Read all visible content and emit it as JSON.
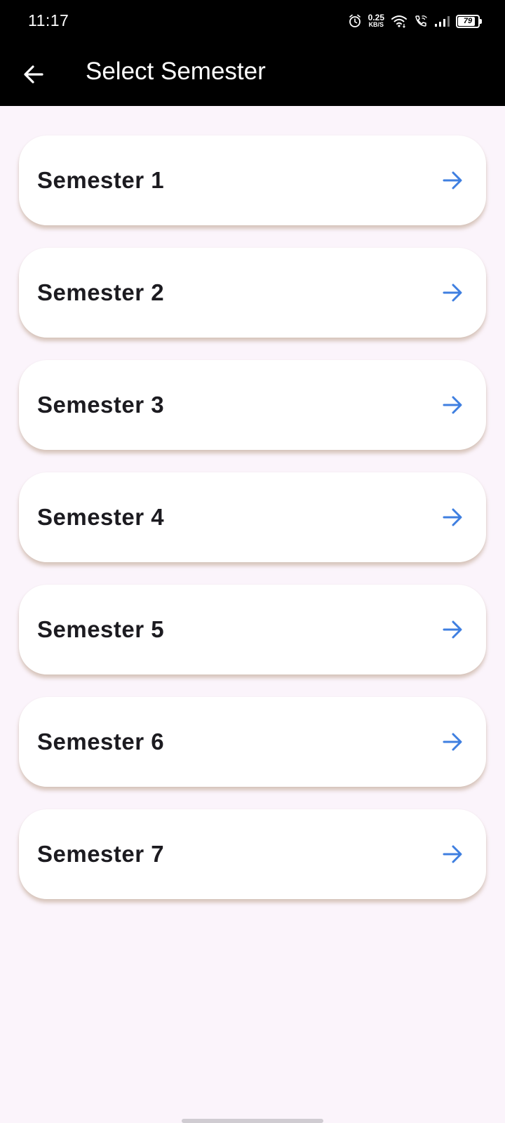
{
  "status_bar": {
    "time": "11:17",
    "net_speed_value": "0.25",
    "net_speed_unit": "KB/S",
    "battery_level": "79",
    "icons": [
      "alarm-icon",
      "wifi-icon",
      "wifi-calling-icon",
      "signal-icon",
      "battery-icon"
    ]
  },
  "app_bar": {
    "back_icon": "arrow-back-icon",
    "title": "Select Semester"
  },
  "semesters": [
    {
      "label": "Semester 1"
    },
    {
      "label": "Semester 2"
    },
    {
      "label": "Semester 3"
    },
    {
      "label": "Semester 4"
    },
    {
      "label": "Semester 5"
    },
    {
      "label": "Semester 6"
    },
    {
      "label": "Semester 7"
    }
  ],
  "colors": {
    "app_bar_background": "#000000",
    "page_background": "#fbf4fb",
    "card_background": "#ffffff",
    "arrow_accent": "#3f7fe0",
    "label_text": "#1c1b20"
  }
}
